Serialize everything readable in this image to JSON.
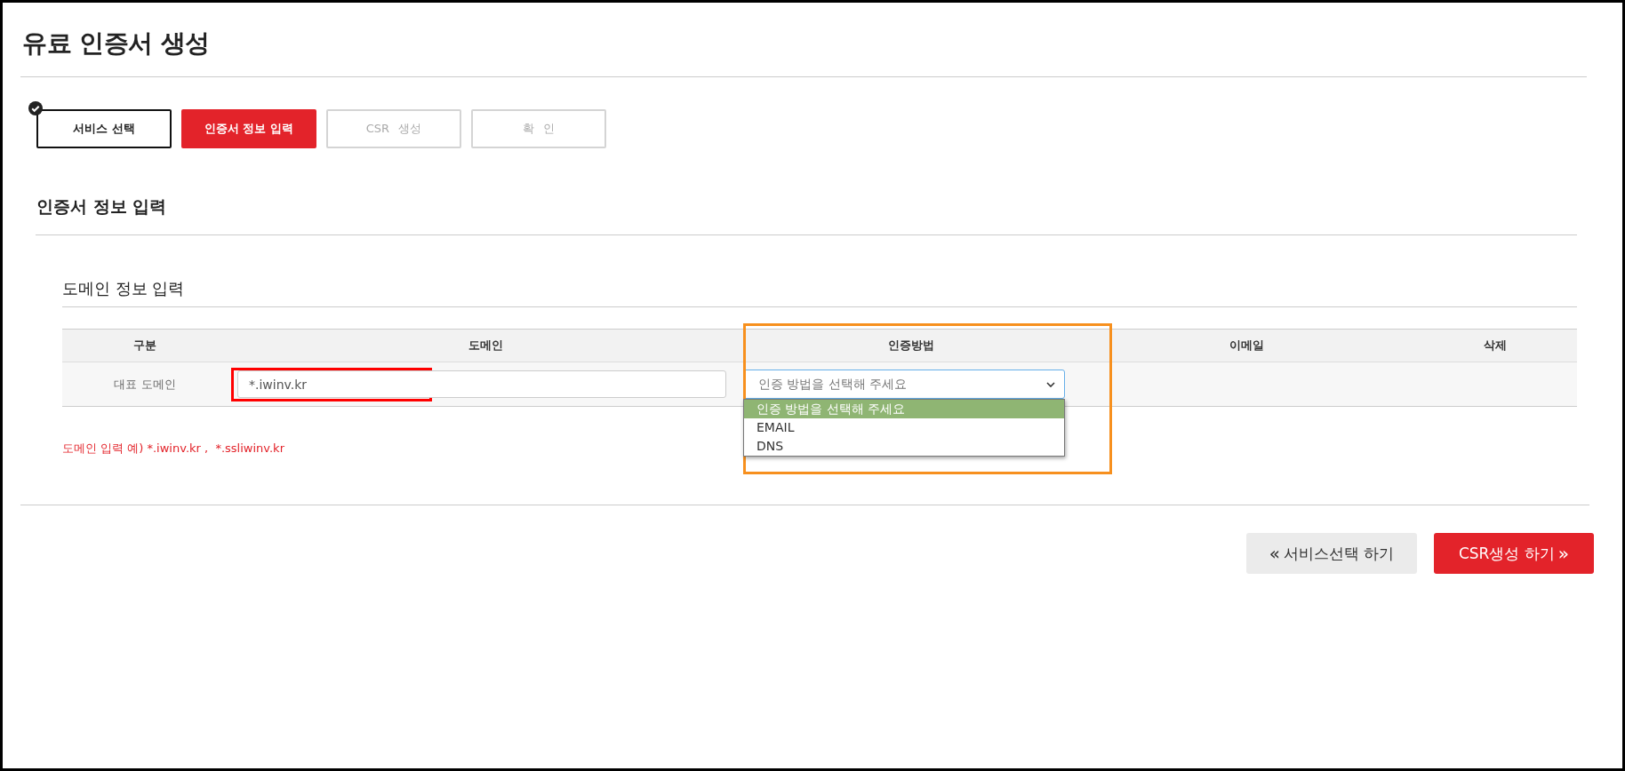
{
  "page": {
    "title": "유료 인증서 생성"
  },
  "steps": [
    {
      "label": "서비스 선택",
      "done": true,
      "selected": false
    },
    {
      "label": "인증서 정보 입력",
      "done": false,
      "selected": true
    },
    {
      "label": "CSR 생성",
      "done": false,
      "selected": false
    },
    {
      "label": "확 인",
      "done": false,
      "selected": false
    }
  ],
  "section_title": "인증서 정보 입력",
  "domain_section": {
    "title": "도메인 정보 입력",
    "columns": [
      {
        "label": "구분",
        "highlighted": false
      },
      {
        "label": "도메인",
        "highlighted": false
      },
      {
        "label": "인증방법",
        "highlighted": true
      },
      {
        "label": "이메일",
        "highlighted": false
      },
      {
        "label": "삭제",
        "highlighted": false
      }
    ],
    "rows": [
      {
        "type": "대표 도메인",
        "domain": {
          "value": "*.iwinv.kr",
          "highlighted": true
        },
        "method": {
          "value": "인증 방법을 선택해 주세요",
          "expanded": true,
          "options": [
            {
              "label": "인증 방법을 선택해 주세요",
              "selected": true
            },
            {
              "label": "EMAIL",
              "selected": false
            },
            {
              "label": "DNS",
              "selected": false
            }
          ]
        }
      }
    ],
    "hint": "도메인 입력 예) *.iwinv.kr ,  *.ssliwinv.kr"
  },
  "buttons": [
    {
      "label": "서비스선택 하기",
      "kind": "back",
      "arrow": "«"
    },
    {
      "label": "CSR생성 하기",
      "kind": "next",
      "arrow": "»"
    }
  ]
}
